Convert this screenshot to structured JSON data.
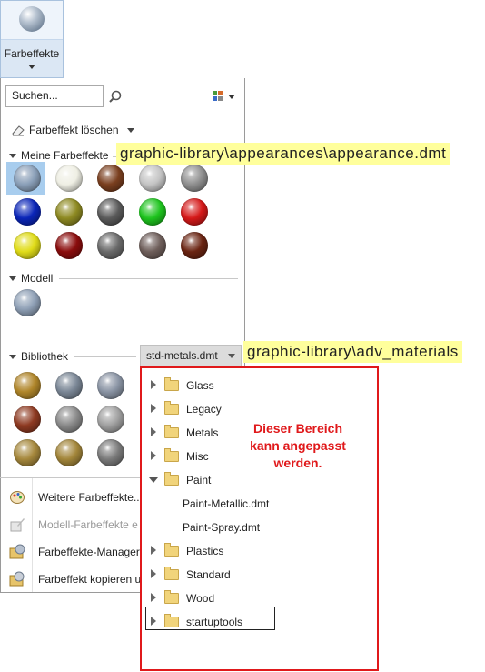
{
  "ribbon": {
    "label": "Farbeffekte"
  },
  "panel": {
    "search_placeholder": "Suchen...",
    "clear_label": "Farbeffekt löschen",
    "my_effects_header": "Meine Farbeffekte",
    "model_header": "Modell",
    "library_header": "Bibliothek",
    "library_file": "std-metals.dmt",
    "menu": [
      {
        "label": "Weitere Farbeffekte...",
        "enabled": true
      },
      {
        "label": "Modell-Farbeffekte e",
        "enabled": false
      },
      {
        "label": "Farbeffekte-Manager",
        "enabled": true
      },
      {
        "label": "Farbeffekt kopieren u",
        "enabled": true
      }
    ],
    "my_effects_colors": [
      "#8a9fb8",
      "#efefe4",
      "#7a3f1f",
      "#c4c4c4",
      "#8f8f8f",
      "#0a25b8",
      "#8e8a22",
      "#5a5a5a",
      "#1ec41e",
      "#d51919",
      "#e0dc18",
      "#8a0c0c",
      "#6a6a6a",
      "#6e5e5a",
      "#6a2412"
    ],
    "model_colors": [
      "#8fa0b6"
    ],
    "library_colors": [
      "#b0862a",
      "#7b8796",
      "#8a94a4",
      "#8e3a22",
      "#8a8a8a",
      "#a0a0a0",
      "#a6883c",
      "#a3863a",
      "#7a7a7a"
    ]
  },
  "callouts": {
    "appearances_path": "graphic-library\\appearances\\appearance.dmt",
    "materials_path": "graphic-library\\adv_materials",
    "note": "Dieser Bereich kann angepasst werden."
  },
  "tree": {
    "items": [
      {
        "label": "Glass",
        "type": "folder",
        "expanded": false
      },
      {
        "label": "Legacy",
        "type": "folder",
        "expanded": false
      },
      {
        "label": "Metals",
        "type": "folder",
        "expanded": false
      },
      {
        "label": "Misc",
        "type": "folder",
        "expanded": false
      },
      {
        "label": "Paint",
        "type": "folder",
        "expanded": true
      },
      {
        "label": "Paint-Metallic.dmt",
        "type": "file"
      },
      {
        "label": "Paint-Spray.dmt",
        "type": "file"
      },
      {
        "label": "Plastics",
        "type": "folder",
        "expanded": false
      },
      {
        "label": "Standard",
        "type": "folder",
        "expanded": false
      },
      {
        "label": "Wood",
        "type": "folder",
        "expanded": false
      },
      {
        "label": "startuptools",
        "type": "folder",
        "expanded": false
      }
    ]
  }
}
